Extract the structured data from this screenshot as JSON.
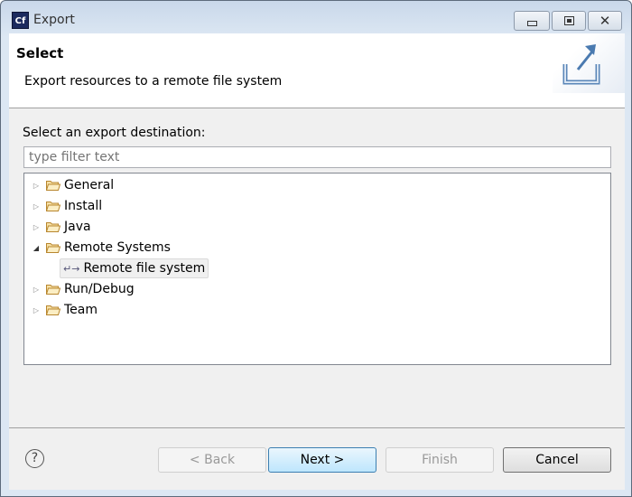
{
  "window": {
    "title": "Export",
    "app_icon_text": "Cf"
  },
  "header": {
    "title": "Select",
    "description": "Export resources to a remote file system"
  },
  "main": {
    "label": "Select an export destination:",
    "filter_placeholder": "type filter text",
    "tree": [
      {
        "label": "General",
        "expanded": false
      },
      {
        "label": "Install",
        "expanded": false
      },
      {
        "label": "Java",
        "expanded": false
      },
      {
        "label": "Remote Systems",
        "expanded": true,
        "children": [
          {
            "label": "Remote file system",
            "selected": true
          }
        ]
      },
      {
        "label": "Run/Debug",
        "expanded": false
      },
      {
        "label": "Team",
        "expanded": false
      }
    ]
  },
  "footer": {
    "help": "?",
    "back": "< Back",
    "next": "Next >",
    "finish": "Finish",
    "cancel": "Cancel"
  }
}
